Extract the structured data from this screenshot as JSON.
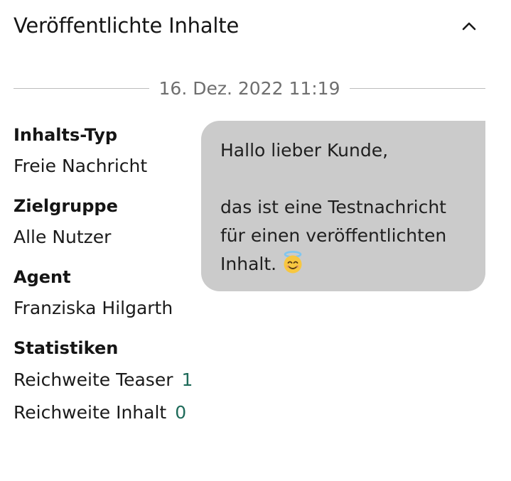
{
  "header": {
    "title": "Veröffentlichte Inhalte",
    "collapse_icon": "chevron-up-icon"
  },
  "date_separator": "16. Dez. 2022 11:19",
  "meta": {
    "content_type_label": "Inhalts-Typ",
    "content_type_value": "Freie Nachricht",
    "audience_label": "Zielgruppe",
    "audience_value": "Alle Nutzer",
    "agent_label": "Agent",
    "agent_value": "Franziska Hilgarth",
    "statistics_label": "Statistiken",
    "stats": [
      {
        "label": "Reichweite Teaser",
        "value": "1"
      },
      {
        "label": "Reichweite Inhalt",
        "value": "0"
      }
    ]
  },
  "message": {
    "greeting": "Hallo lieber Kunde,",
    "body": "das ist eine Testnachricht für einen veröffentlichten Inhalt.",
    "emoji": "smiling-face-with-halo-emoji"
  },
  "colors": {
    "bubble": "#cbcbcb",
    "stat_accent": "#1f6b5a",
    "date_text": "#6f6f6f"
  }
}
